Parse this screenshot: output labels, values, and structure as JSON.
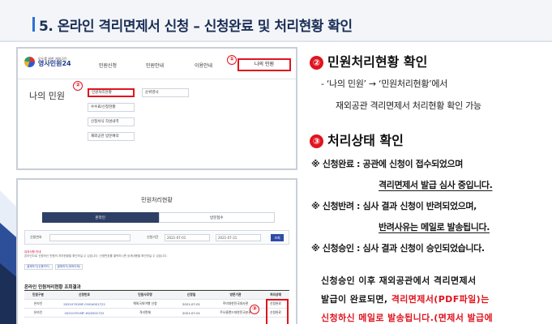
{
  "slide": {
    "title": "5. 온라인 격리면제서 신청 – 신청완료 및 처리현황 확인"
  },
  "screenshot1": {
    "logo_sub": "모두를 위한 재외국민",
    "logo_main": "영사민원24",
    "nav": [
      "민원신청",
      "민원안내",
      "이용안내",
      "나의 민원"
    ],
    "sub_title": "나의 민원",
    "menu": [
      "민원처리현황",
      "수수료/신청현황",
      "신청서식 작성내역",
      "재외공관 방문예약",
      "순위영사"
    ],
    "markers": [
      "①",
      "②"
    ]
  },
  "screenshot2": {
    "title": "민원처리현황",
    "tabs": [
      "온라인",
      "방문접수"
    ],
    "filter": {
      "label_no": "신청번호",
      "label_date": "신청기간",
      "date_from": "2021-07-01",
      "date_to": "2021-07-31",
      "search_btn": "조회"
    },
    "notice_red": "유의사항 안내",
    "notice": "온라인으로 신청하신 민원의 처리현황을 확인하실 수 있습니다. 신청번호를 클릭하시면 상세내용을 확인하실 수 있습니다.",
    "links": [
      "결제하기(신용카드)",
      "결제하기(계좌이체)"
    ],
    "results_title": "온라인 민원처리현황 조회결과",
    "headers": [
      "민원구분",
      "신청번호",
      "민원사무명",
      "신청일",
      "방문기관",
      "처리상태"
    ],
    "rows": [
      [
        "온라인",
        "20210701MF-CHG4001722",
        "해외국외여행 신청",
        "2021-07-01",
        "주미대한민국대사관",
        "신청완료"
      ],
      [
        "온라인",
        "20210701MF-HQ5001722",
        "격리면제",
        "2021-07-01",
        "주오클랜드대한민국분관",
        "신청완료"
      ]
    ],
    "marker": "③"
  },
  "right": {
    "h2_num": "②",
    "h2_text": "민원처리현황 확인",
    "line1": "- ‘나의 민원’ → ‘민원처리현황’에서",
    "line2": "재외공관 격리면제서 처리현황 확인 가능",
    "h3_num": "③",
    "h3_text": "처리상태 확인",
    "notes": [
      {
        "label": "※ 신청완료 : ",
        "l1": "공관에 신청이 접수되었으며",
        "l2": "격리면제서 발급 심사 중입니다."
      },
      {
        "label": "※ 신청반려 : ",
        "l1": "심사 결과 신청이 반려되었으며,",
        "l2": "반려사유는 메일로 발송됩니다."
      },
      {
        "label": "※ 신청승인 : ",
        "l1": "심사 결과 신청이 승인되었습니다.",
        "l2": ""
      }
    ],
    "para_l1": "신청승인 이후 재외공관에서 격리면제서",
    "para_l2_a": "발급이 완료되면, ",
    "para_l2_b": "격리면제서(PDF파일)는",
    "para_l3": "신청하신 메일로 발송됩니다.(면제서 발급에"
  },
  "colors": {
    "accent_red": "#e0141e",
    "title_navy": "#1b2f57",
    "deco_blue": "#2d6fd6"
  }
}
